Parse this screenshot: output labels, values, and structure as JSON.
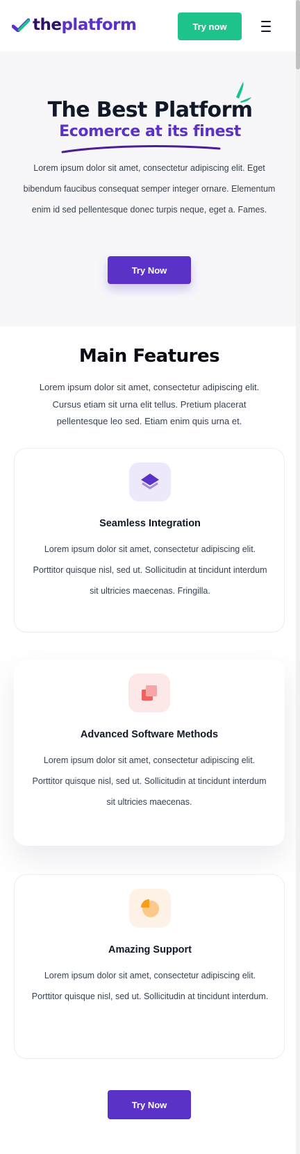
{
  "header": {
    "logo_the": "the",
    "logo_platform": "platform",
    "try_button": "Try now"
  },
  "hero": {
    "title": "The Best Platform",
    "subtitle": "Ecomerce at its finest",
    "description": "Lorem ipsum dolor sit amet, consectetur adipiscing elit. Eget bibendum faucibus consequat semper integer ornare. Elementum enim id sed pellentesque donec turpis neque, eget a. Fames.",
    "button": "Try Now"
  },
  "features": {
    "title": "Main Features",
    "description": "Lorem ipsum dolor sit amet, consectetur adipiscing elit. Cursus etiam sit urna elit tellus. Pretium placerat pellentesque leo sed. Etiam enim quis urna et.",
    "cards": [
      {
        "title": "Seamless Integration",
        "description": "Lorem ipsum dolor sit amet, consectetur adipiscing elit. Porttitor quisque nisl, sed ut. Sollicitudin at tincidunt interdum sit ultricies maecenas. Fringilla.",
        "icon": "layers-icon"
      },
      {
        "title": "Advanced Software Methods",
        "description": "Lorem ipsum dolor sit amet, consectetur adipiscing elit. Porttitor quisque nisl, sed ut. Sollicitudin at tincidunt interdum sit ultricies maecenas.",
        "icon": "stacked-squares-icon"
      },
      {
        "title": "Amazing Support",
        "description": "Lorem ipsum dolor sit amet, consectetur adipiscing elit. Porttitor quisque nisl, sed ut. Sollicitudin at tincidunt interdum.",
        "icon": "pie-chart-icon"
      }
    ],
    "bottom_button": "Try Now"
  },
  "colors": {
    "brand_purple": "#5b32c7",
    "brand_green": "#1ec28b",
    "dark_navy": "#111827",
    "hero_bg": "#f7f7fa"
  }
}
